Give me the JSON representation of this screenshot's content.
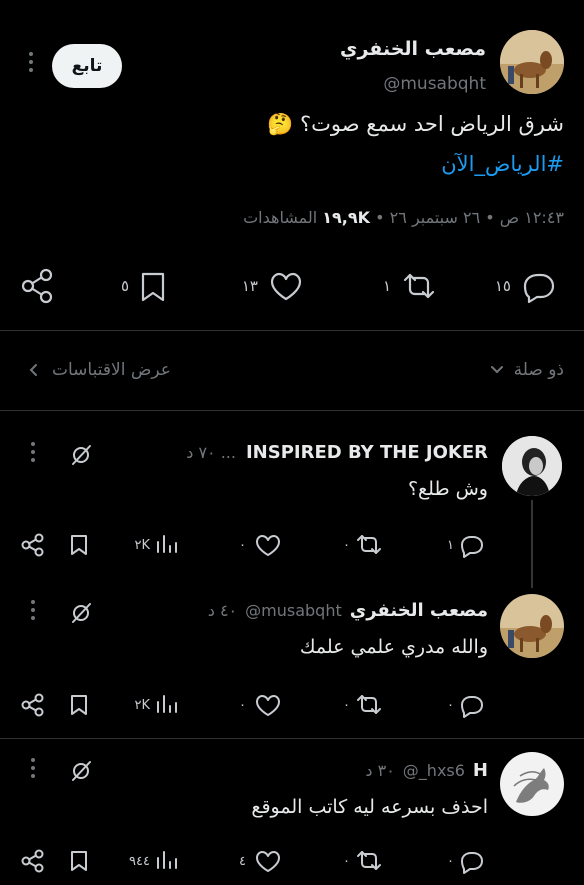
{
  "tweet": {
    "display_name": "مصعب الخنفري",
    "handle": "@musabqht",
    "follow_label": "تابع",
    "text": "شرق الرياض احد سمع صوت؟ 🤔",
    "hashtag": "#الرياض_الآن",
    "meta_time": "١٢:٤٣ ص • ٢٦ سبتمبر ٢٦ •",
    "meta_views_count": "١٩,٩K",
    "meta_views_label": "المشاهدات",
    "actions": {
      "replies": "١٥",
      "retweets": "١",
      "likes": "١٣",
      "bookmarks": "٥"
    }
  },
  "sort_bar": {
    "relevant_label": "ذو صلة",
    "quotes_label": "عرض الاقتباسات"
  },
  "replies": [
    {
      "display_name": "INSPIRED BY THE JOKER",
      "handle": "... ٧٠ د",
      "text": "وش طلع؟",
      "replies": "١",
      "retweets": "٠",
      "likes": "٠",
      "views": "٢K"
    },
    {
      "display_name": "مصعب الخنفري",
      "handle": "@musabqht",
      "time": "٤٠ د",
      "text": "والله مدري علمي علمك",
      "replies": "٠",
      "retweets": "٠",
      "likes": "٠",
      "views": "٢K"
    },
    {
      "display_name": "H",
      "handle": "@_hxs6",
      "time": "٣٠ د",
      "text": "احذف بسرعه ليه كاتب الموقع",
      "replies": "٠",
      "retweets": "٠",
      "likes": "٤",
      "views": "٩٤٤"
    }
  ],
  "colors": {
    "background": "#000000",
    "text": "#e7e9ea",
    "muted": "#71767b",
    "link": "#1d9bf0",
    "follow_bg": "#eff3f4"
  }
}
